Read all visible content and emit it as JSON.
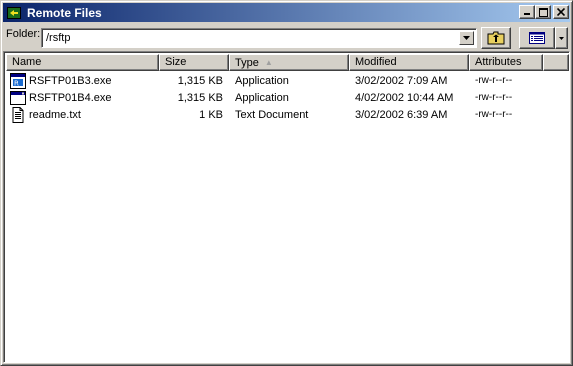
{
  "window": {
    "title": "Remote Files"
  },
  "toolbar": {
    "folder_label": "Folder:",
    "folder_value": "/rsftp"
  },
  "columns": [
    "Name",
    "Size",
    "Type",
    "Modified",
    "Attributes"
  ],
  "sort_column": "Type",
  "files": [
    {
      "name": "RSFTP01B3.exe",
      "size": "1,315 KB",
      "type": "Application",
      "modified": "3/02/2002 7:09 AM",
      "attributes": "-rw-r--r--",
      "icon": "exe-icon"
    },
    {
      "name": "RSFTP01B4.exe",
      "size": "1,315 KB",
      "type": "Application",
      "modified": "4/02/2002 10:44 AM",
      "attributes": "-rw-r--r--",
      "icon": "exe-window-icon"
    },
    {
      "name": "readme.txt",
      "size": "1 KB",
      "type": "Text Document",
      "modified": "3/02/2002 6:39 AM",
      "attributes": "-rw-r--r--",
      "icon": "text-file-icon"
    }
  ],
  "colors": {
    "title_start": "#0a246a",
    "title_end": "#a6caf0",
    "face": "#d4d0c8"
  }
}
